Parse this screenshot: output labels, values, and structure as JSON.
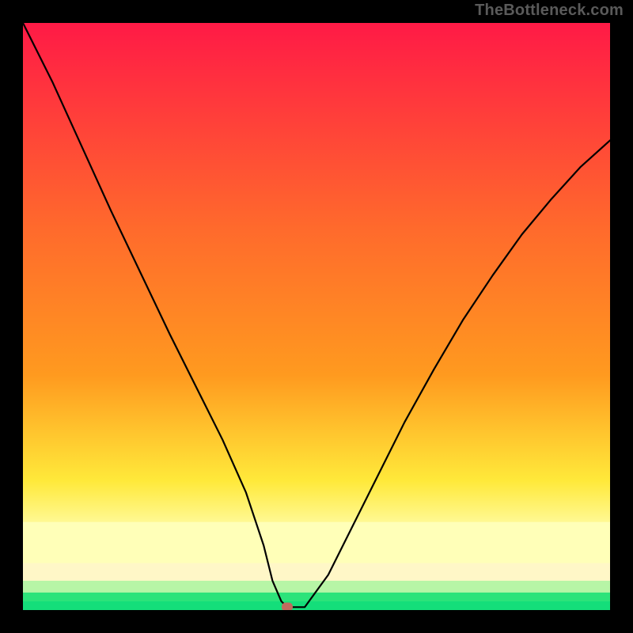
{
  "watermark": "TheBottleneck.com",
  "colors": {
    "black": "#000000",
    "red_top": "#ff1a46",
    "orange": "#ff9a1f",
    "yellow": "#ffe93a",
    "pale_yellow": "#ffffb8",
    "band_cream": "#fff7c7",
    "band_pale_green": "#b7f5a6",
    "band_green": "#2ce37a",
    "green_bottom": "#14de7a",
    "curve": "#000000",
    "marker": "#c06a5e",
    "watermark": "#5a5a5a"
  },
  "chart_data": {
    "type": "line",
    "title": "",
    "xlabel": "",
    "ylabel": "",
    "xlim": [
      0,
      100
    ],
    "ylim": [
      0,
      100
    ],
    "series": [
      {
        "name": "bottleneck-curve",
        "x": [
          0,
          5,
          10,
          15,
          20,
          25,
          30,
          34,
          38,
          41,
          42.5,
          44,
          45,
          46,
          48,
          52,
          56,
          60,
          65,
          70,
          75,
          80,
          85,
          90,
          95,
          100
        ],
        "y": [
          100,
          90,
          79,
          68,
          57.5,
          47,
          37,
          29,
          20,
          11,
          5,
          1.5,
          0.5,
          0.5,
          0.5,
          6,
          14,
          22,
          32,
          41,
          49.5,
          57,
          64,
          70,
          75.5,
          80
        ]
      }
    ],
    "marker": {
      "x": 45,
      "y": 0.5
    },
    "background_bands_y": [
      {
        "from": 0,
        "to": 1.5,
        "color": "green_bottom"
      },
      {
        "from": 1.5,
        "to": 3,
        "color": "band_green"
      },
      {
        "from": 3,
        "to": 5,
        "color": "band_pale_green"
      },
      {
        "from": 5,
        "to": 8,
        "color": "band_cream"
      },
      {
        "from": 8,
        "to": 15,
        "color": "pale_yellow"
      },
      {
        "from": 15,
        "to": 100,
        "color": "gradient_red_yellow"
      }
    ]
  },
  "layout": {
    "image_size": 800,
    "plot_inset": 29,
    "plot_size": 742
  }
}
